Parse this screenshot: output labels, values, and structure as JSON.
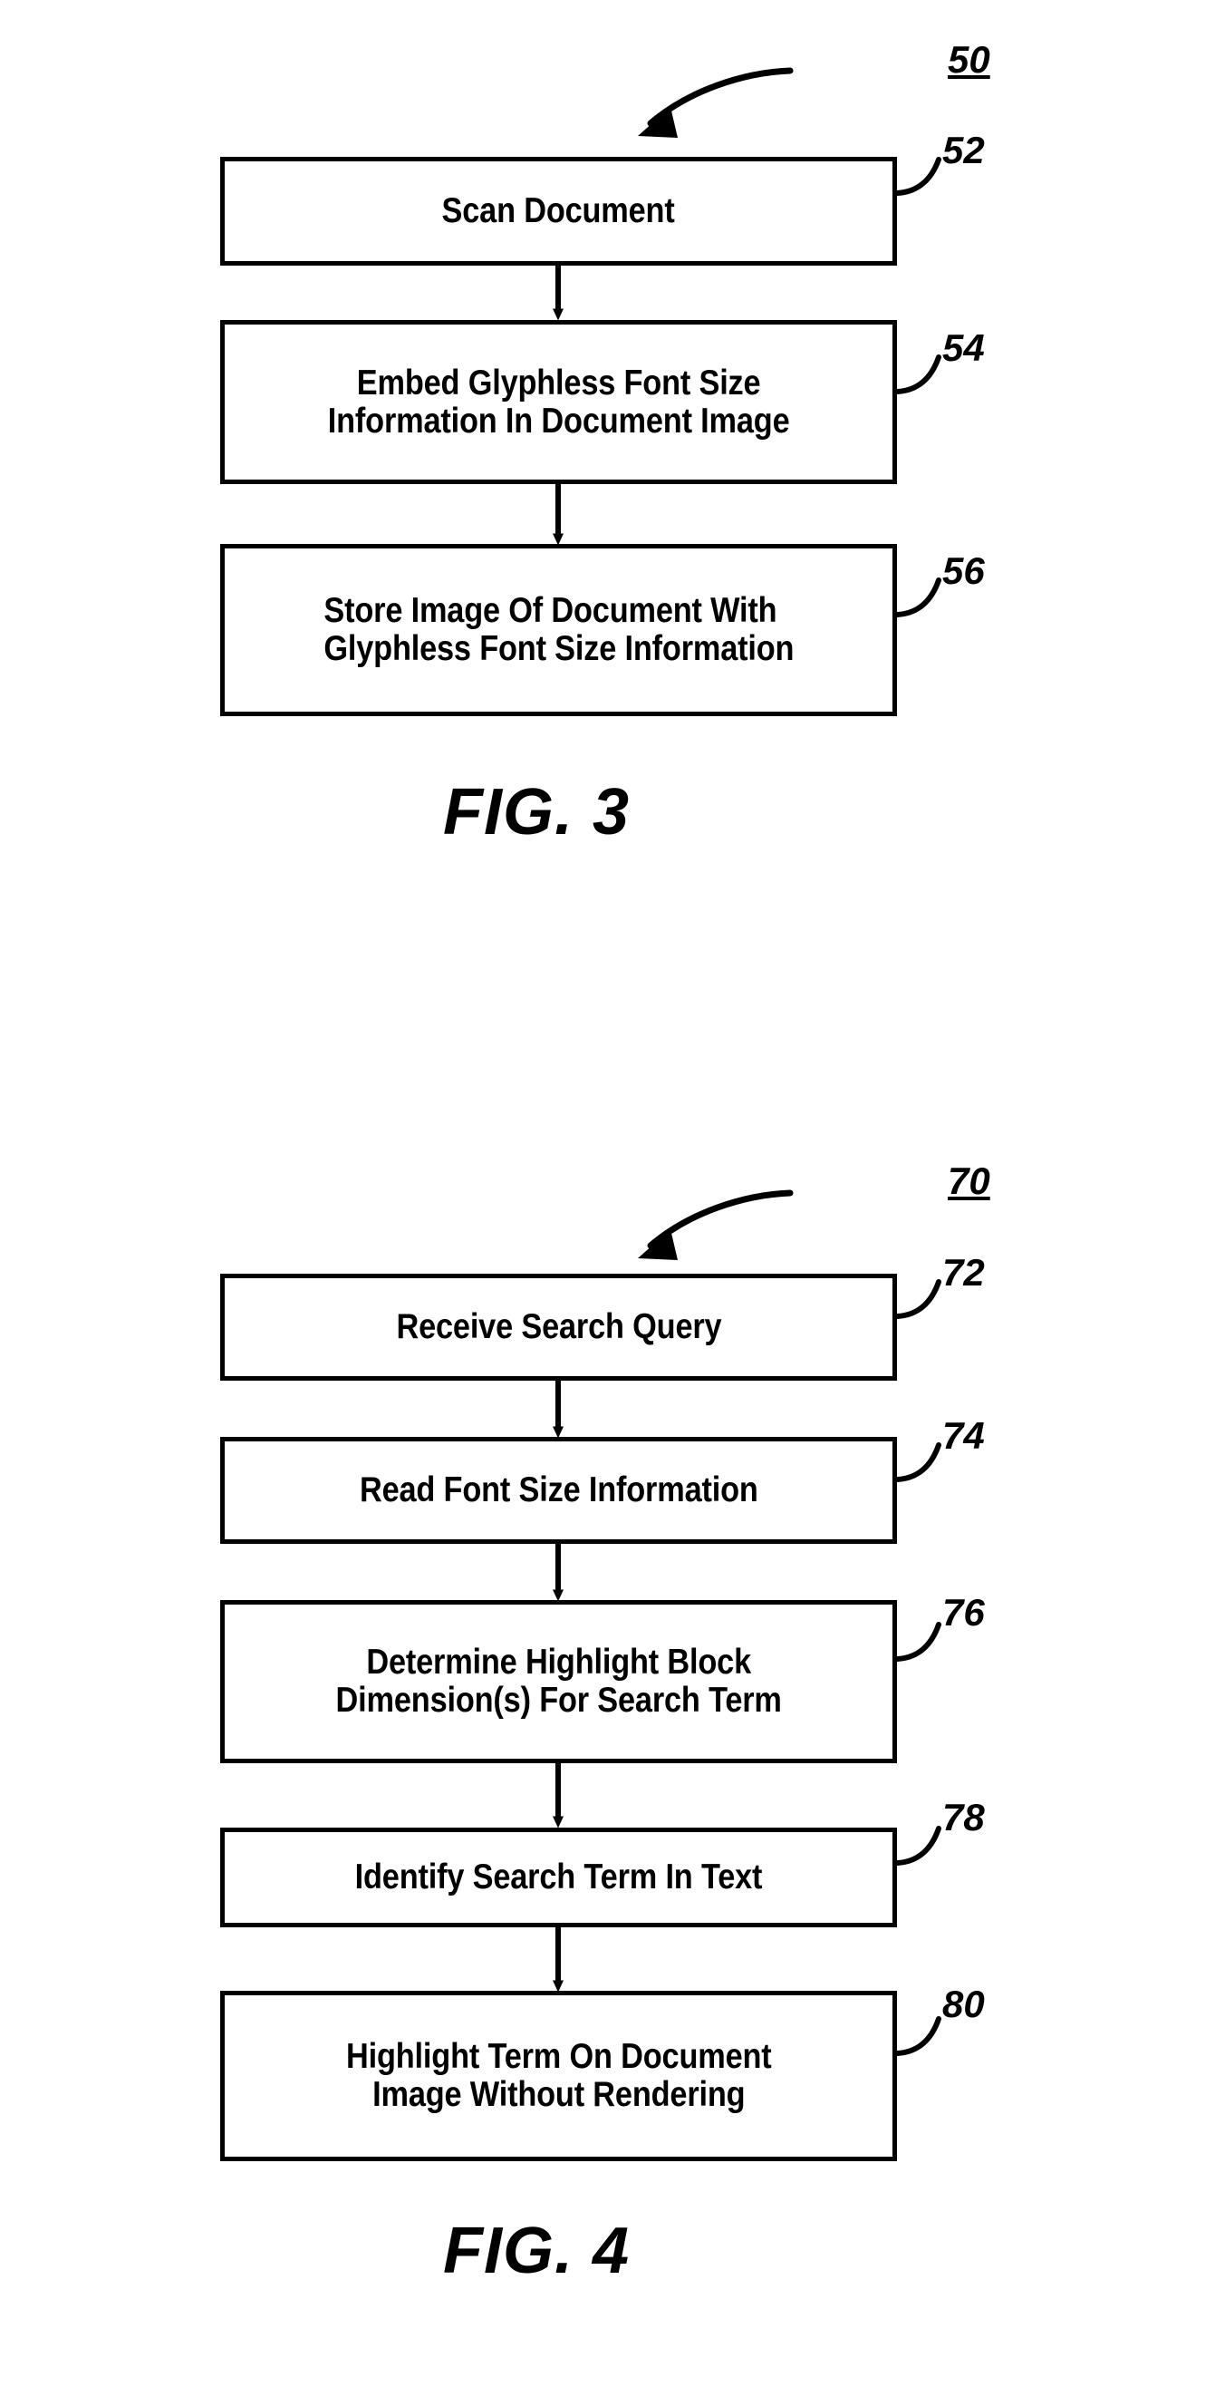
{
  "figures": [
    {
      "id": "fig3",
      "caption": "FIG. 3",
      "flow_label": "50",
      "steps": [
        {
          "ref": "52",
          "text": "Scan Document"
        },
        {
          "ref": "54",
          "text": "Embed Glyphless Font Size\nInformation In Document Image"
        },
        {
          "ref": "56",
          "text": "Store Image Of Document With\nGlyphless Font Size Information"
        }
      ]
    },
    {
      "id": "fig4",
      "caption": "FIG. 4",
      "flow_label": "70",
      "steps": [
        {
          "ref": "72",
          "text": "Receive Search Query"
        },
        {
          "ref": "74",
          "text": "Read Font Size Information"
        },
        {
          "ref": "76",
          "text": "Determine Highlight Block\nDimension(s) For Search Term"
        },
        {
          "ref": "78",
          "text": "Identify Search Term In Text"
        },
        {
          "ref": "80",
          "text": "Highlight Term On Document\nImage Without Rendering"
        }
      ]
    }
  ],
  "colors": {
    "ink": "#000000",
    "paper": "#ffffff"
  }
}
